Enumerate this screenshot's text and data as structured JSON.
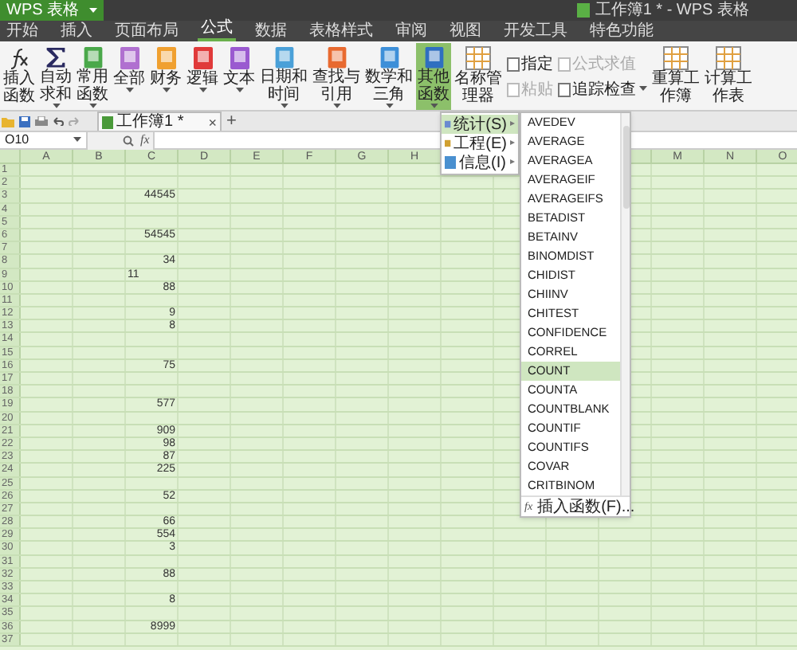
{
  "window": {
    "app_button": "WPS 表格",
    "title": "工作簿1 * - WPS 表格"
  },
  "menu_tabs": [
    {
      "label": "开始",
      "selected": false
    },
    {
      "label": "插入",
      "selected": false
    },
    {
      "label": "页面布局",
      "selected": false
    },
    {
      "label": "公式",
      "selected": true
    },
    {
      "label": "数据",
      "selected": false
    },
    {
      "label": "表格样式",
      "selected": false
    },
    {
      "label": "审阅",
      "selected": false
    },
    {
      "label": "视图",
      "selected": false
    },
    {
      "label": "开发工具",
      "selected": false
    },
    {
      "label": "特色功能",
      "selected": false
    }
  ],
  "ribbon": [
    {
      "kind": "function",
      "label": "插入函数",
      "dropdown": false,
      "selected": false
    },
    {
      "kind": "sum",
      "label": "自动求和",
      "dropdown": true,
      "selected": false
    },
    {
      "kind": "category",
      "label": "常用函数",
      "dropdown": true,
      "selected": false
    },
    {
      "kind": "category",
      "label": "全部",
      "dropdown": true,
      "selected": false
    },
    {
      "kind": "category",
      "label": "财务",
      "dropdown": true,
      "selected": false
    },
    {
      "kind": "category",
      "label": "逻辑",
      "dropdown": true,
      "selected": false
    },
    {
      "kind": "category",
      "label": "文本",
      "dropdown": true,
      "selected": false
    },
    {
      "kind": "category",
      "label": "日期和时间",
      "dropdown": true,
      "selected": false
    },
    {
      "kind": "category",
      "label": "查找与引用",
      "dropdown": true,
      "selected": false
    },
    {
      "kind": "category",
      "label": "数学和三角",
      "dropdown": true,
      "selected": false
    },
    {
      "kind": "category",
      "label": "其他函数",
      "dropdown": true,
      "selected": true
    },
    {
      "kind": "tool",
      "label": "名称管理器",
      "dropdown": false,
      "selected": false
    },
    {
      "kind": "stack",
      "items": [
        {
          "label": "指定",
          "disabled": false,
          "dropdown": false
        },
        {
          "label": "粘贴",
          "disabled": true,
          "dropdown": false
        }
      ]
    },
    {
      "kind": "stack",
      "items": [
        {
          "label": "公式求值",
          "disabled": true,
          "dropdown": false
        },
        {
          "label": "追踪检查",
          "disabled": false,
          "dropdown": true
        }
      ]
    },
    {
      "kind": "tool",
      "label": "重算工作簿",
      "dropdown": false,
      "selected": false
    },
    {
      "kind": "tool",
      "label": "计算工作表",
      "dropdown": false,
      "selected": false
    }
  ],
  "document_tab": {
    "label": "工作簿1 *",
    "close": "×",
    "new": "+"
  },
  "formula_bar": {
    "name_box": "O10",
    "fx": "fx"
  },
  "columns_left": [
    "A",
    "B",
    "C",
    "D",
    "E",
    "F",
    "G",
    "H"
  ],
  "columns_right": [
    "M",
    "N",
    "O"
  ],
  "rows": [
    {
      "label": "1"
    },
    {
      "label": "2"
    },
    {
      "label": "3",
      "c": "44545"
    },
    {
      "label": "4"
    },
    {
      "label": "5"
    },
    {
      "label": "6",
      "c": "54545"
    },
    {
      "label": "7"
    },
    {
      "label": "8",
      "c": "34"
    },
    {
      "label": "9",
      "c": "11",
      "kind": "text"
    },
    {
      "label": "10",
      "c": "88"
    },
    {
      "label": "11"
    },
    {
      "label": "12",
      "c": "9"
    },
    {
      "label": "13",
      "c": "8"
    },
    {
      "label": "14"
    },
    {
      "label": "15"
    },
    {
      "label": "16",
      "c": "75"
    },
    {
      "label": "17"
    },
    {
      "label": "18"
    },
    {
      "label": "19",
      "c": "577"
    },
    {
      "label": "20"
    },
    {
      "label": "21",
      "c": "909"
    },
    {
      "label": "22",
      "c": "98"
    },
    {
      "label": "23",
      "c": "87"
    },
    {
      "label": "24",
      "c": "225"
    },
    {
      "label": "25"
    },
    {
      "label": "26",
      "c": "52"
    },
    {
      "label": "27"
    },
    {
      "label": "28",
      "c": "66"
    },
    {
      "label": "29",
      "c": "554"
    },
    {
      "label": "30",
      "c": "3"
    },
    {
      "label": "31"
    },
    {
      "label": "32",
      "c": "88"
    },
    {
      "label": "33"
    },
    {
      "label": "34",
      "c": "8"
    },
    {
      "label": "35"
    },
    {
      "label": "36",
      "c": "8999"
    },
    {
      "label": "37"
    }
  ],
  "category_menu": [
    {
      "label": "统计(S)",
      "arrow": "▸",
      "selected": true
    },
    {
      "label": "工程(E)",
      "arrow": "▸",
      "selected": false
    },
    {
      "label": "信息(I)",
      "arrow": "▸",
      "selected": false
    }
  ],
  "function_menu": {
    "items": [
      {
        "label": "AVEDEV",
        "selected": false
      },
      {
        "label": "AVERAGE",
        "selected": false
      },
      {
        "label": "AVERAGEA",
        "selected": false
      },
      {
        "label": "AVERAGEIF",
        "selected": false
      },
      {
        "label": "AVERAGEIFS",
        "selected": false
      },
      {
        "label": "BETADIST",
        "selected": false
      },
      {
        "label": "BETAINV",
        "selected": false
      },
      {
        "label": "BINOMDIST",
        "selected": false
      },
      {
        "label": "CHIDIST",
        "selected": false
      },
      {
        "label": "CHIINV",
        "selected": false
      },
      {
        "label": "CHITEST",
        "selected": false
      },
      {
        "label": "CONFIDENCE",
        "selected": false
      },
      {
        "label": "CORREL",
        "selected": false
      },
      {
        "label": "COUNT",
        "selected": true
      },
      {
        "label": "COUNTA",
        "selected": false
      },
      {
        "label": "COUNTBLANK",
        "selected": false
      },
      {
        "label": "COUNTIF",
        "selected": false
      },
      {
        "label": "COUNTIFS",
        "selected": false
      },
      {
        "label": "COVAR",
        "selected": false
      },
      {
        "label": "CRITBINOM",
        "selected": false
      }
    ],
    "footer_icon": "fx",
    "footer": "插入函数(F)..."
  }
}
